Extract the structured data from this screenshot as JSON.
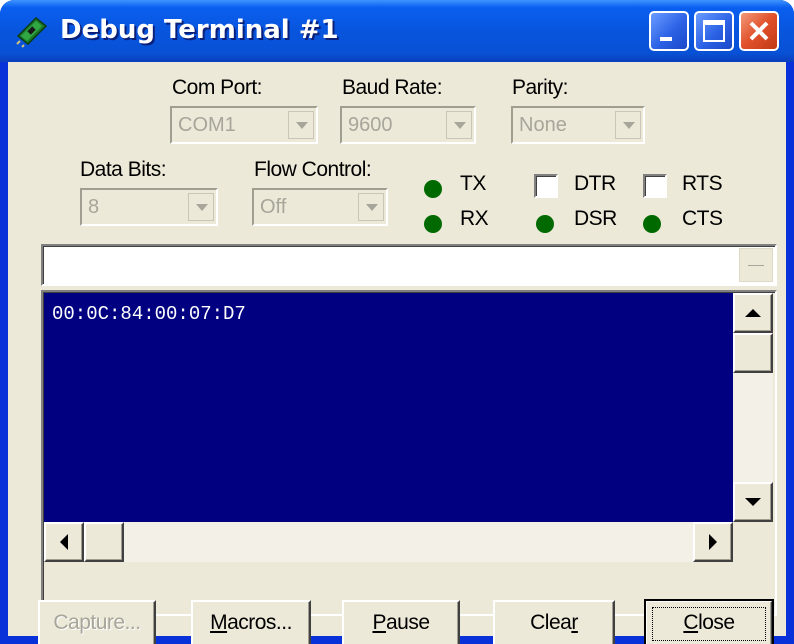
{
  "window": {
    "title": "Debug Terminal #1",
    "icon": "circuit-board-icon",
    "titlebar_buttons": [
      "minimize-icon",
      "maximize-icon",
      "close-icon"
    ]
  },
  "settings": {
    "com_port": {
      "label": "Com Port:",
      "value": "COM1"
    },
    "baud_rate": {
      "label": "Baud Rate:",
      "value": "9600"
    },
    "parity": {
      "label": "Parity:",
      "value": "None"
    },
    "data_bits": {
      "label": "Data Bits:",
      "value": "8"
    },
    "flow_control": {
      "label": "Flow Control:",
      "value": "Off"
    }
  },
  "indicators": {
    "tx": {
      "label": "TX"
    },
    "rx": {
      "label": "RX"
    },
    "dsr": {
      "label": "DSR"
    },
    "cts": {
      "label": "CTS"
    },
    "led_color": "#006a00"
  },
  "checkboxes": {
    "dtr": {
      "label": "DTR",
      "checked": false
    },
    "rts": {
      "label": "RTS",
      "checked": false
    }
  },
  "terminal": {
    "input_value": "",
    "output": "00:0C:84:00:07:D7",
    "background": "#000080",
    "text_color": "#ffffff"
  },
  "buttons": {
    "capture": {
      "label": "Capture...",
      "enabled": false
    },
    "macros": {
      "pre": "",
      "mnemonic": "M",
      "post": "acros..."
    },
    "pause": {
      "pre": "",
      "mnemonic": "P",
      "post": "ause"
    },
    "clear": {
      "pre": "Clea",
      "mnemonic": "r",
      "post": ""
    },
    "close": {
      "pre": "",
      "mnemonic": "C",
      "post": "lose"
    }
  }
}
